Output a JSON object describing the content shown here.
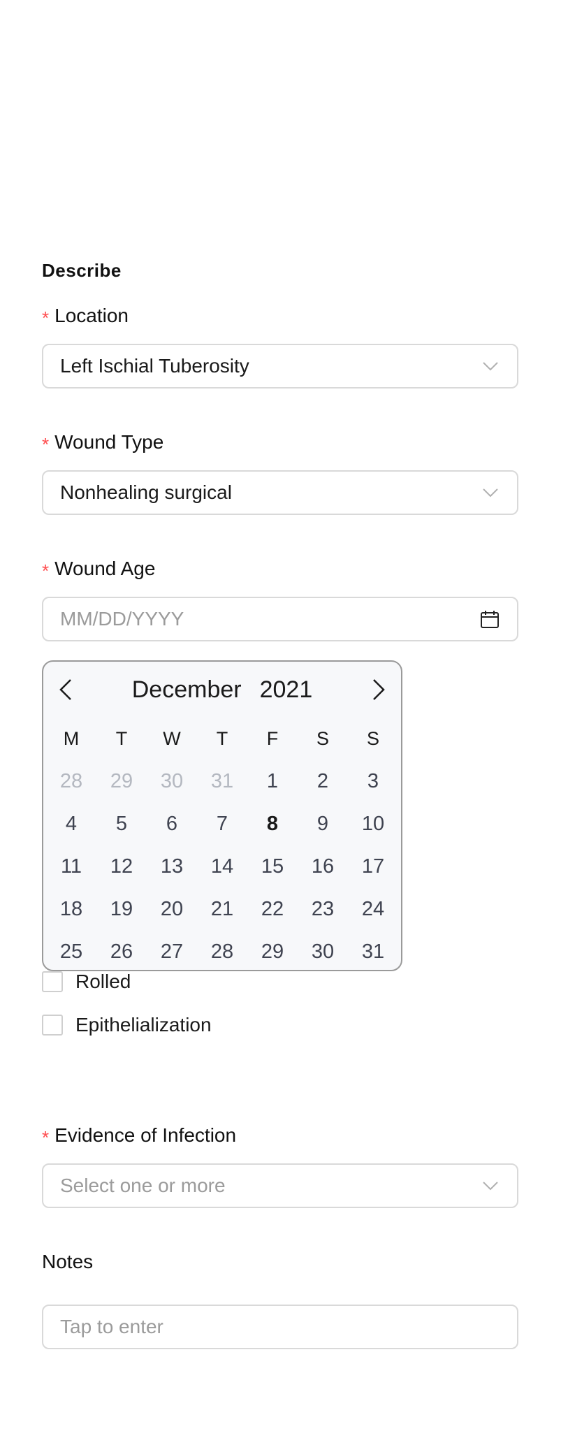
{
  "section_title": "Describe",
  "required_marker": "*",
  "location": {
    "label": "Location",
    "value": "Left Ischial Tuberosity"
  },
  "wound_type": {
    "label": "Wound Type",
    "value": "Nonhealing surgical"
  },
  "wound_age": {
    "label": "Wound Age",
    "placeholder": "MM/DD/YYYY"
  },
  "calendar": {
    "month": "December",
    "year": "2021",
    "weekdays": [
      "M",
      "T",
      "W",
      "T",
      "F",
      "S",
      "S"
    ],
    "weeks": [
      [
        "28",
        "29",
        "30",
        "31",
        "1",
        "2",
        "3"
      ],
      [
        "4",
        "5",
        "6",
        "7",
        "8",
        "9",
        "10"
      ],
      [
        "11",
        "12",
        "13",
        "14",
        "15",
        "16",
        "17"
      ],
      [
        "18",
        "19",
        "20",
        "21",
        "22",
        "23",
        "24"
      ],
      [
        "25",
        "26",
        "27",
        "28",
        "29",
        "30",
        "31"
      ]
    ],
    "outside_month_days": [
      "28",
      "29",
      "30",
      "31"
    ],
    "highlighted_day": "8"
  },
  "checkboxes": [
    {
      "label": "Rolled",
      "checked": false
    },
    {
      "label": "Epithelialization",
      "checked": false
    }
  ],
  "evidence_of_infection": {
    "label": "Evidence of Infection",
    "placeholder": "Select one or more"
  },
  "notes": {
    "label": "Notes",
    "placeholder": "Tap to enter"
  },
  "colors": {
    "required": "#ff4d4f",
    "border": "#d9d9d9",
    "placeholder": "#9b9b9b",
    "calendar_bg": "#f7f8fa",
    "muted_day": "#b4b8c0"
  },
  "icons": {
    "dropdown": "chevron-down-icon",
    "date": "calendar-icon",
    "prev": "chevron-left-icon",
    "next": "chevron-right-icon"
  }
}
